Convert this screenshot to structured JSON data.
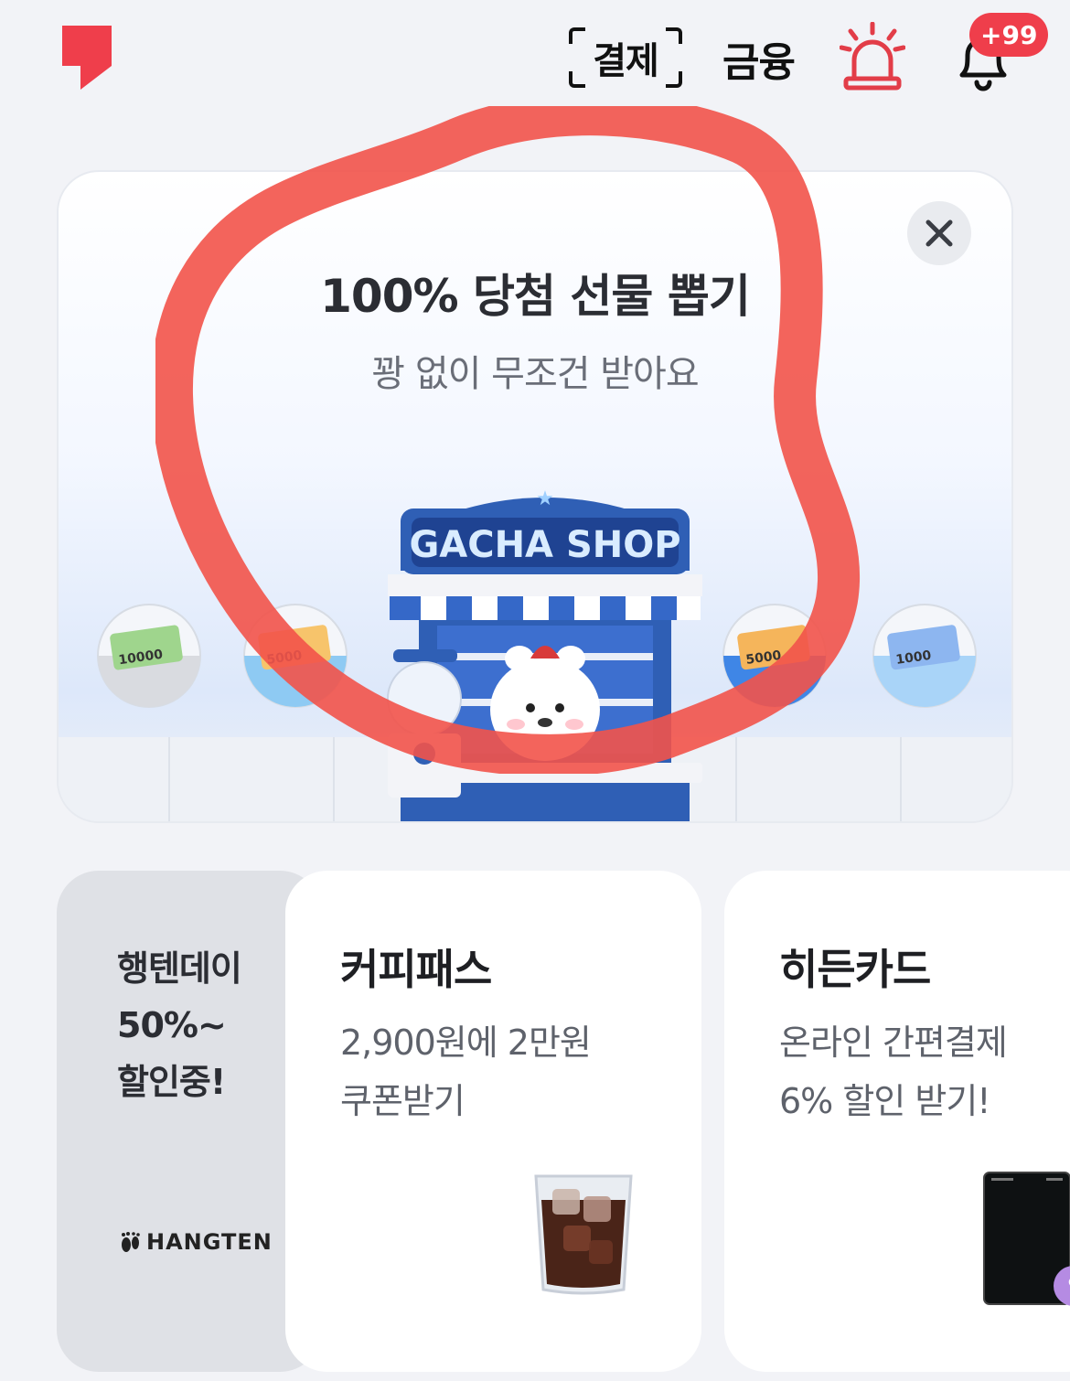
{
  "header": {
    "pay_label": "결제",
    "finance_label": "금융",
    "notification_count": "+99"
  },
  "banner": {
    "title": "100% 당첨 선물 뽑기",
    "subtitle": "꽝 없이 무조건 받아요",
    "shop_sign": "GACHA SHOP",
    "capsule_notes": [
      "10000",
      "5000",
      "5000",
      "1000"
    ]
  },
  "cards": {
    "hangten": {
      "lines": [
        "행텐데이",
        "50%~",
        "할인중!"
      ],
      "brand": "HANGTEN"
    },
    "coffee_pass": {
      "title": "커피패스",
      "desc_line1": "2,900원에 2만원",
      "desc_line2": "쿠폰받기"
    },
    "hidden_card": {
      "title": "히든카드",
      "desc_line1": "온라인 간편결제",
      "desc_line2": "6% 할인 받기!"
    }
  },
  "colors": {
    "brand_red": "#ef3e4b",
    "scribble": "#f2534a",
    "shop_blue": "#2f5fb5"
  }
}
